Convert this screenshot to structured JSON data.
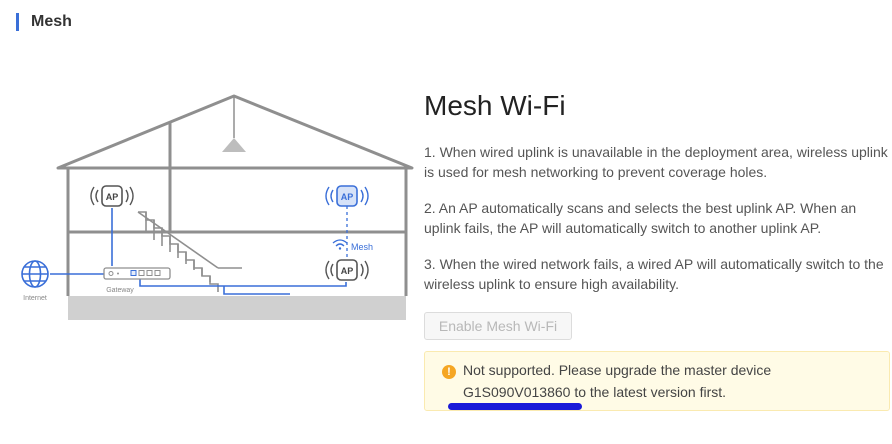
{
  "section": {
    "title": "Mesh"
  },
  "diagram": {
    "internet_label": "Internet",
    "gateway_label": "Gateway",
    "mesh_label": "Mesh",
    "ap_label": "AP"
  },
  "content": {
    "heading": "Mesh Wi-Fi",
    "paragraphs": [
      "1. When wired uplink is unavailable in the deployment area, wireless uplink is used for mesh networking to prevent coverage holes.",
      "2. An AP automatically scans and selects the best uplink AP. When an uplink fails, the AP will automatically switch to another uplink AP.",
      "3. When the wired network fails, a wired AP will automatically switch to the wireless uplink to ensure high availability."
    ]
  },
  "actions": {
    "enable_label": "Enable Mesh Wi-Fi"
  },
  "warning": {
    "icon": "!",
    "line1": "Not supported. Please upgrade the master device",
    "line2": "G1S090V013860 to the latest version first."
  },
  "colors": {
    "accent": "#3a6fd8",
    "warning_bg": "#fffbe6",
    "warning_icon": "#f5a623",
    "annotation": "#1a1ad8"
  }
}
